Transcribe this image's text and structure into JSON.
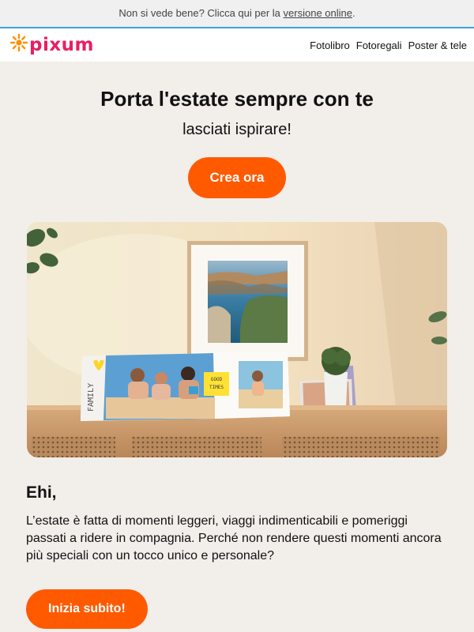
{
  "topbar": {
    "text": "Non si vede bene? Clicca qui per la",
    "link": "versione online",
    "suffix": "."
  },
  "header": {
    "logo": "pixum",
    "nav": [
      {
        "label": "Fotolibro"
      },
      {
        "label": "Fotoregali"
      },
      {
        "label": "Poster & tele"
      }
    ]
  },
  "hero": {
    "title": "Porta l'estate sempre con te",
    "subtitle": "lasciati ispirare!",
    "cta": "Crea ora"
  },
  "image": {
    "book_cover_text": "FAMILY",
    "sticker_text_1": "GOOD",
    "sticker_text_2": "TIMES"
  },
  "content": {
    "greeting": "Ehi,",
    "body": "L’estate è fatta di momenti leggeri, viaggi indimenticabili e pomeriggi passati a ridere in compagnia. Perché non rendere questi momenti ancora più speciali con un tocco unico e personale?",
    "cta": "Inizia subito!"
  },
  "colors": {
    "accent": "#ff5a00",
    "logo_pink": "#e91e63",
    "logo_orange": "#ff8f00",
    "background": "#f2eeea",
    "topbar_line": "#3aa0e0"
  }
}
